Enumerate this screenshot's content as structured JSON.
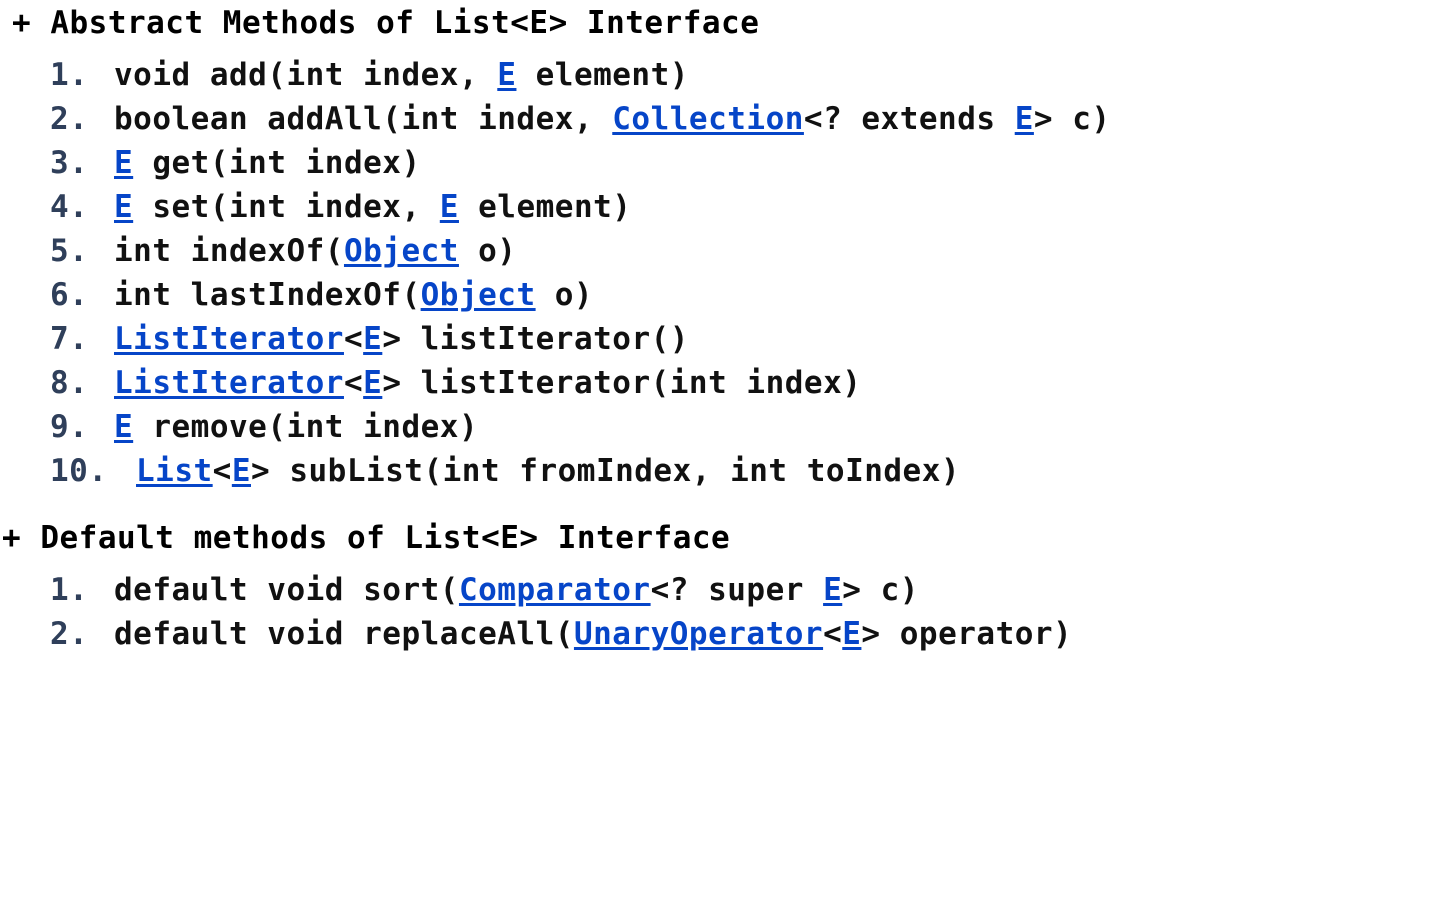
{
  "abstract_section": {
    "title": "+ Abstract Methods of List<E> Interface",
    "items": [
      {
        "num": "1.",
        "parts": [
          {
            "t": "void add(int index, "
          },
          {
            "t": "E",
            "link": true
          },
          {
            "t": " element)"
          }
        ]
      },
      {
        "num": "2.",
        "parts": [
          {
            "t": "boolean addAll(int index, "
          },
          {
            "t": "Collection",
            "link": true
          },
          {
            "t": "<? extends "
          },
          {
            "t": "E",
            "link": true
          },
          {
            "t": "> c)"
          }
        ]
      },
      {
        "num": "3.",
        "parts": [
          {
            "t": "E",
            "link": true
          },
          {
            "t": " get(int index)"
          }
        ]
      },
      {
        "num": "4.",
        "parts": [
          {
            "t": "E",
            "link": true
          },
          {
            "t": " set(int index, "
          },
          {
            "t": "E",
            "link": true
          },
          {
            "t": " element)"
          }
        ]
      },
      {
        "num": "5.",
        "parts": [
          {
            "t": "int indexOf("
          },
          {
            "t": "Object",
            "link": true
          },
          {
            "t": " o)"
          }
        ]
      },
      {
        "num": "6.",
        "parts": [
          {
            "t": "int lastIndexOf("
          },
          {
            "t": "Object",
            "link": true
          },
          {
            "t": " o)"
          }
        ]
      },
      {
        "num": "7.",
        "parts": [
          {
            "t": "ListIterator",
            "link": true
          },
          {
            "t": "<"
          },
          {
            "t": "E",
            "link": true
          },
          {
            "t": "> listIterator()"
          }
        ]
      },
      {
        "num": "8.",
        "parts": [
          {
            "t": "ListIterator",
            "link": true
          },
          {
            "t": "<"
          },
          {
            "t": "E",
            "link": true
          },
          {
            "t": "> listIterator(int index)"
          }
        ]
      },
      {
        "num": "9.",
        "parts": [
          {
            "t": "E",
            "link": true
          },
          {
            "t": " remove(int index)"
          }
        ]
      },
      {
        "num": "10.",
        "parts": [
          {
            "t": "List",
            "link": true
          },
          {
            "t": "<"
          },
          {
            "t": "E",
            "link": true
          },
          {
            "t": "> subList(int fromIndex, int toIndex)"
          }
        ]
      }
    ]
  },
  "default_section": {
    "title": "+ Default methods of List<E> Interface",
    "items": [
      {
        "num": "1.",
        "parts": [
          {
            "t": "default void sort("
          },
          {
            "t": "Comparator",
            "link": true
          },
          {
            "t": "<? super "
          },
          {
            "t": "E",
            "link": true
          },
          {
            "t": "> c)"
          }
        ]
      },
      {
        "num": "2.",
        "parts": [
          {
            "t": "default void replaceAll("
          },
          {
            "t": "UnaryOperator",
            "link": true
          },
          {
            "t": "<"
          },
          {
            "t": "E",
            "link": true
          },
          {
            "t": "> operator)"
          }
        ]
      }
    ]
  }
}
